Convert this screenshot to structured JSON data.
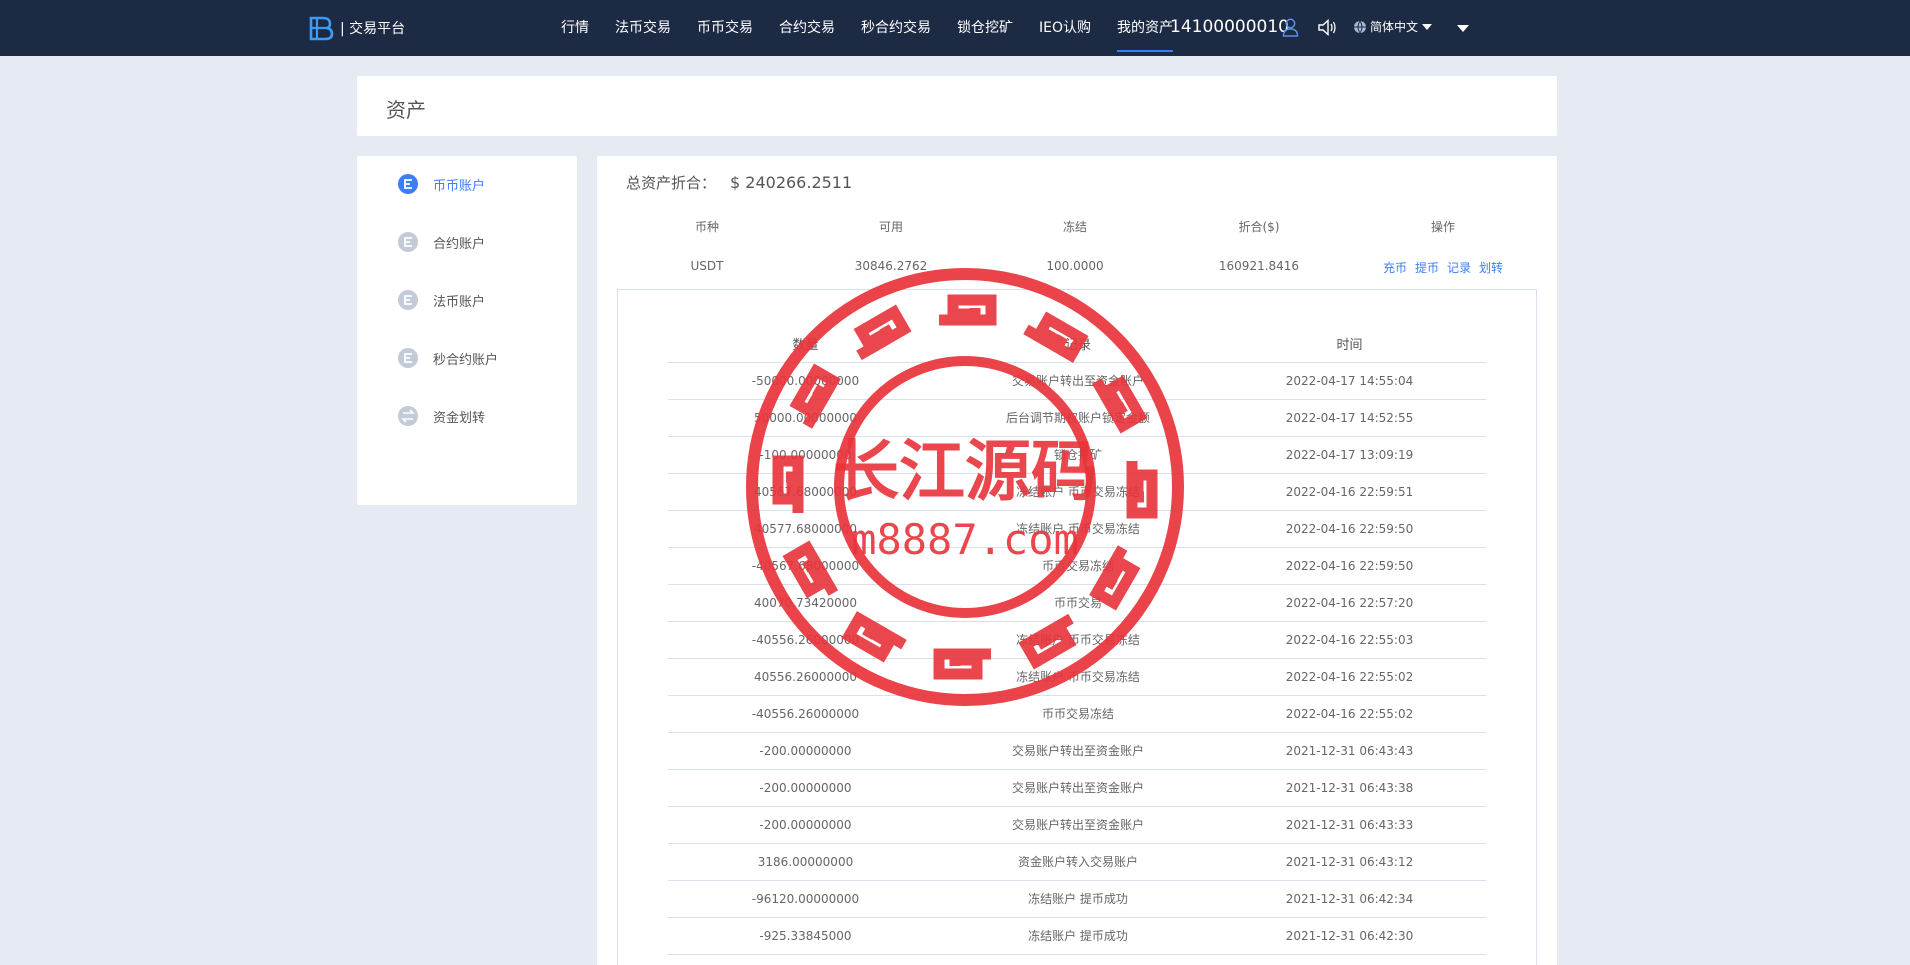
{
  "nav": {
    "brand": "| 交易平台",
    "items": [
      "行情",
      "法币交易",
      "币币交易",
      "合约交易",
      "秒合约交易",
      "锁仓挖矿",
      "IEO认购",
      "我的资产"
    ],
    "active_index": 7,
    "phone": "14100000010",
    "language": "简体中文"
  },
  "page": {
    "title": "资产"
  },
  "sidebar": {
    "items": [
      {
        "label": "币币账户",
        "icon": "currency-icon",
        "active": true
      },
      {
        "label": "合约账户",
        "icon": "currency-icon",
        "active": false
      },
      {
        "label": "法币账户",
        "icon": "currency-icon",
        "active": false
      },
      {
        "label": "秒合约账户",
        "icon": "currency-icon",
        "active": false
      },
      {
        "label": "资金划转",
        "icon": "transfer-icon",
        "active": false
      }
    ]
  },
  "summary": {
    "label": "总资产折合：",
    "value": "$ 240266.2511"
  },
  "asset_table": {
    "headers": [
      "币种",
      "可用",
      "冻结",
      "折合($)",
      "操作"
    ],
    "row": {
      "coin": "USDT",
      "available": "30846.2762",
      "frozen": "100.0000",
      "equivalent": "160921.8416",
      "actions": [
        "充币",
        "提币",
        "记录",
        "划转"
      ]
    }
  },
  "records": {
    "headers": [
      "数量",
      "记录",
      "时间"
    ],
    "rows": [
      [
        "-50000.00000000",
        "交易账户转出至资金账户",
        "2022-04-17 14:55:04"
      ],
      [
        "50000.00000000",
        "后台调节期权账户锁定金额",
        "2022-04-17 14:52:55"
      ],
      [
        "-100.00000000",
        "锁仓挖矿",
        "2022-04-17 13:09:19"
      ],
      [
        "40567.68000000",
        "冻结账户 币币交易冻结",
        "2022-04-16 22:59:51"
      ],
      [
        "40577.68000000",
        "冻结账户 币币交易冻结",
        "2022-04-16 22:59:50"
      ],
      [
        "-40567.68000000",
        "币币交易冻结",
        "2022-04-16 22:59:50"
      ],
      [
        "40070.73420000",
        "币币交易",
        "2022-04-16 22:57:20"
      ],
      [
        "-40556.26000000",
        "冻结账户 币币交易冻结",
        "2022-04-16 22:55:03"
      ],
      [
        "40556.26000000",
        "冻结账户 币币交易冻结",
        "2022-04-16 22:55:02"
      ],
      [
        "-40556.26000000",
        "币币交易冻结",
        "2022-04-16 22:55:02"
      ],
      [
        "-200.00000000",
        "交易账户转出至资金账户",
        "2021-12-31 06:43:43"
      ],
      [
        "-200.00000000",
        "交易账户转出至资金账户",
        "2021-12-31 06:43:38"
      ],
      [
        "-200.00000000",
        "交易账户转出至资金账户",
        "2021-12-31 06:43:33"
      ],
      [
        "3186.00000000",
        "资金账户转入交易账户",
        "2021-12-31 06:43:12"
      ],
      [
        "-96120.00000000",
        "冻结账户 提币成功",
        "2021-12-31 06:42:34"
      ],
      [
        "-925.33845000",
        "冻结账户 提币成功",
        "2021-12-31 06:42:30"
      ]
    ]
  },
  "watermark": {
    "line1": "长江源码",
    "line2": "m8887.com"
  },
  "colors": {
    "nav_bg": "#1d2a44",
    "accent": "#3d7ef7",
    "page_bg": "#e6eaf3",
    "seal": "#e8333a"
  }
}
